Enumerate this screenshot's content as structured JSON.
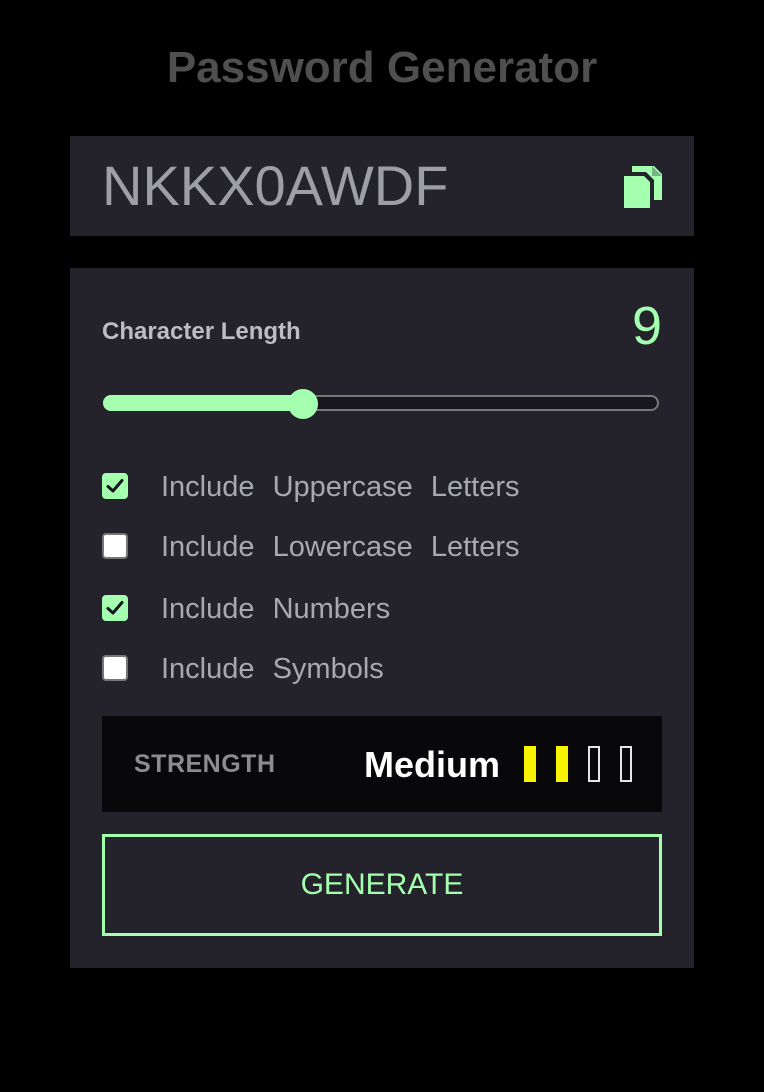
{
  "app": {
    "title": "Password Generator"
  },
  "password": {
    "value": "NKKX0AWDF",
    "copy_icon": "copy-icon"
  },
  "length": {
    "label": "Character Length",
    "value": "9",
    "slider_fraction": 0.36
  },
  "options": [
    {
      "label": "Include Uppercase Letters",
      "checked": true
    },
    {
      "label": "Include Lowercase Letters",
      "checked": false
    },
    {
      "label": "Include Numbers",
      "checked": true
    },
    {
      "label": "Include Symbols",
      "checked": false
    }
  ],
  "strength": {
    "label": "STRENGTH",
    "value": "Medium",
    "level": 2,
    "max_level": 4
  },
  "generate": {
    "label": "GENERATE"
  },
  "colors": {
    "accent": "#a4ffaf",
    "bar_filled": "#f8f400",
    "panel": "#24232b",
    "background": "#000000"
  }
}
